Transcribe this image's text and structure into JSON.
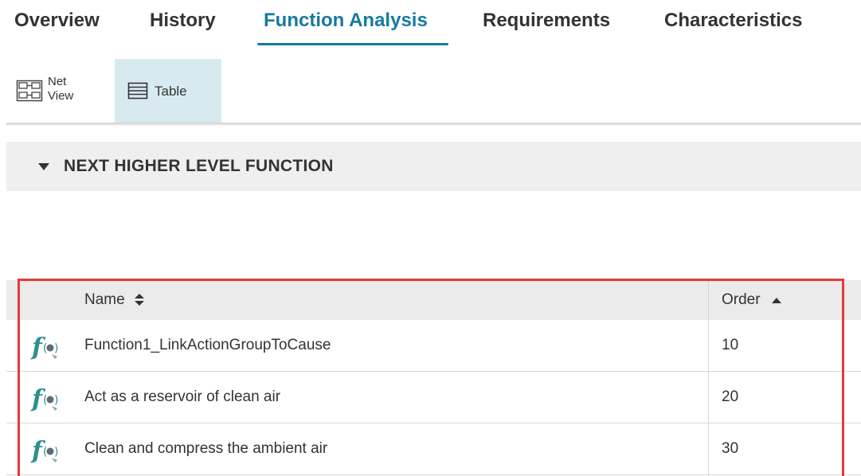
{
  "tabs": [
    {
      "label": "Overview",
      "active": false
    },
    {
      "label": "History",
      "active": false
    },
    {
      "label": "Function Analysis",
      "active": true
    },
    {
      "label": "Requirements",
      "active": false
    },
    {
      "label": "Characteristics",
      "active": false
    }
  ],
  "views": {
    "net_label": "Net View",
    "net_label_line1": "Net",
    "net_label_line2": "View",
    "table_label": "Table",
    "selected": "Table"
  },
  "section": {
    "title": "NEXT HIGHER LEVEL FUNCTION",
    "expanded": true
  },
  "table": {
    "columns": [
      {
        "label": "Name",
        "sort": "none"
      },
      {
        "label": "Order",
        "sort": "ascending"
      }
    ],
    "rows": [
      {
        "name": "Function1_LinkActionGroupToCause",
        "order": "10",
        "icon": "function-icon"
      },
      {
        "name": "Act as a reservoir of clean air",
        "order": "20",
        "icon": "function-icon"
      },
      {
        "name": "Clean and compress the ambient air",
        "order": "30",
        "icon": "function-icon"
      }
    ]
  },
  "colors": {
    "accent": "#167aa0",
    "selected_view_bg": "#d8eaf0",
    "highlight_border": "#e53935",
    "header_bg": "#efefef",
    "function_icon": "#2f8f8f"
  }
}
